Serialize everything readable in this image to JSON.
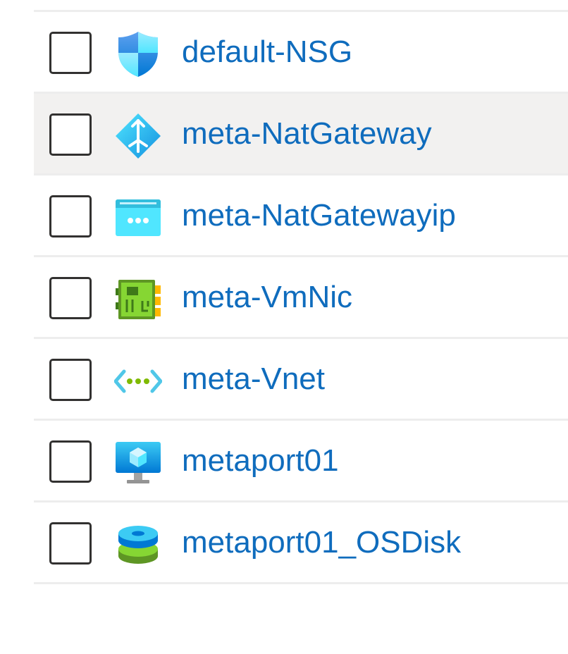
{
  "resources": [
    {
      "name": "default-NSG",
      "icon": "network-security-group-icon"
    },
    {
      "name": "meta-NatGateway",
      "icon": "nat-gateway-icon"
    },
    {
      "name": "meta-NatGatewayip",
      "icon": "public-ip-address-icon"
    },
    {
      "name": "meta-VmNic",
      "icon": "network-interface-icon"
    },
    {
      "name": "meta-Vnet",
      "icon": "virtual-network-icon"
    },
    {
      "name": "metaport01",
      "icon": "virtual-machine-icon"
    },
    {
      "name": "metaport01_OSDisk",
      "icon": "managed-disk-icon"
    }
  ],
  "colors": {
    "link": "#0f6cbd",
    "row_hover": "#f2f1f0",
    "divider": "#ededed",
    "checkbox_border": "#323130"
  }
}
